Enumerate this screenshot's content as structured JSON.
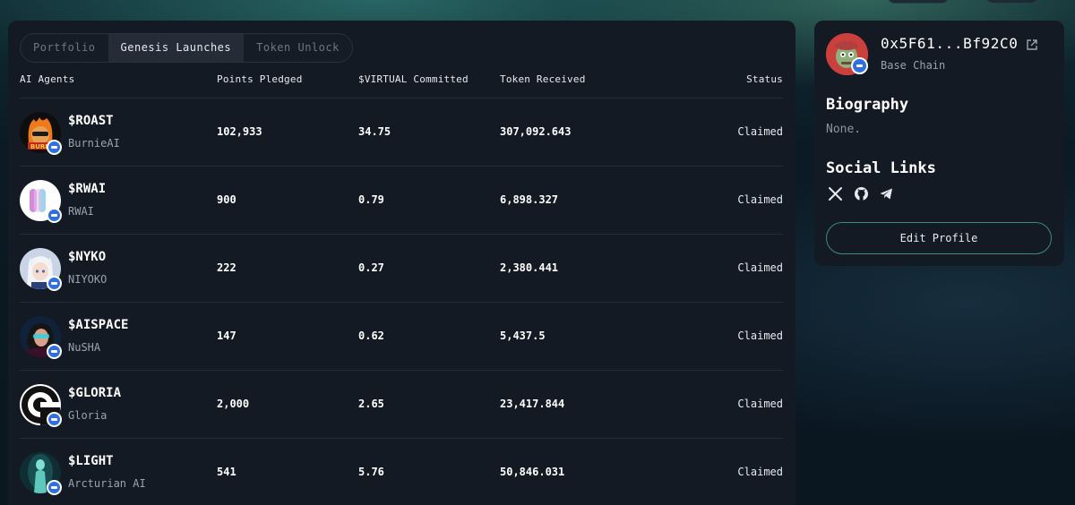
{
  "tabs": [
    "Portfolio",
    "Genesis Launches",
    "Token Unlock"
  ],
  "active_tab": "Genesis Launches",
  "table": {
    "headers": {
      "agents": "AI Agents",
      "points": "Points Pledged",
      "virtual": "$VIRTUAL Committed",
      "received": "Token Received",
      "status": "Status"
    },
    "rows": [
      {
        "ticker": "$ROAST",
        "name": "BurnieAI",
        "points": "102,933",
        "virtual": "34.75",
        "received": "307,092.643",
        "status": "Claimed"
      },
      {
        "ticker": "$RWAI",
        "name": "RWAI",
        "points": "900",
        "virtual": "0.79",
        "received": "6,898.327",
        "status": "Claimed"
      },
      {
        "ticker": "$NYKO",
        "name": "NIYOKO",
        "points": "222",
        "virtual": "0.27",
        "received": "2,380.441",
        "status": "Claimed"
      },
      {
        "ticker": "$AISPACE",
        "name": "NuSHA",
        "points": "147",
        "virtual": "0.62",
        "received": "5,437.5",
        "status": "Claimed"
      },
      {
        "ticker": "$GLORIA",
        "name": "Gloria",
        "points": "2,000",
        "virtual": "2.65",
        "received": "23,417.844",
        "status": "Claimed"
      },
      {
        "ticker": "$LIGHT",
        "name": "Arcturian AI",
        "points": "541",
        "virtual": "5.76",
        "received": "50,846.031",
        "status": "Claimed"
      }
    ]
  },
  "profile": {
    "address": "0x5F61...Bf92C0",
    "chain": "Base Chain",
    "biography_title": "Biography",
    "biography": "None.",
    "social_title": "Social Links",
    "social_icons": [
      "x-icon",
      "github-icon",
      "telegram-icon"
    ],
    "edit_label": "Edit Profile"
  },
  "colors": {
    "panel": "#141a24",
    "accent_border": "#3a8a86",
    "chain_badge": "#2f6fe0"
  }
}
